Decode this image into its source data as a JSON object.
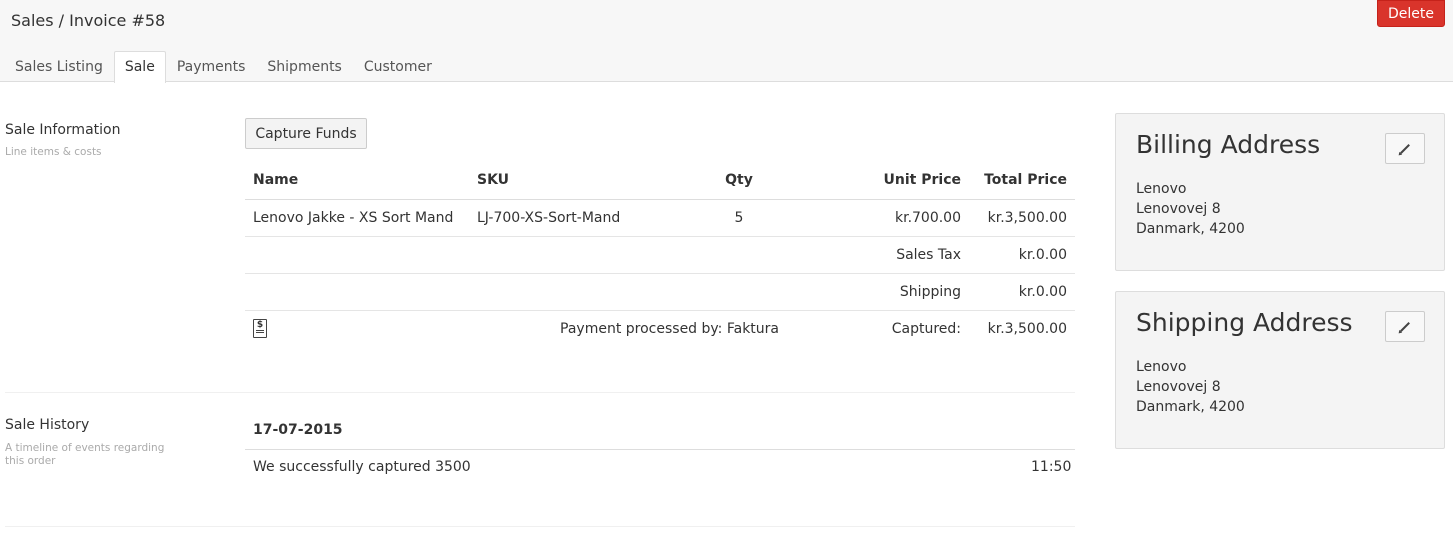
{
  "header": {
    "title": "Sales / Invoice #58",
    "delete_label": "Delete"
  },
  "tabs": [
    {
      "label": "Sales Listing",
      "active": false
    },
    {
      "label": "Sale",
      "active": true
    },
    {
      "label": "Payments",
      "active": false
    },
    {
      "label": "Shipments",
      "active": false
    },
    {
      "label": "Customer",
      "active": false
    }
  ],
  "sale_info": {
    "title": "Sale Information",
    "subtitle": "Line items & costs",
    "capture_label": "Capture Funds",
    "columns": {
      "name": "Name",
      "sku": "SKU",
      "qty": "Qty",
      "unit_price": "Unit Price",
      "total_price": "Total Price"
    },
    "items": [
      {
        "name": "Lenovo Jakke - XS Sort Mand",
        "sku": "LJ-700-XS-Sort-Mand",
        "qty": "5",
        "unit_price": "kr.700.00",
        "total_price": "kr.3,500.00"
      }
    ],
    "sales_tax_label": "Sales Tax",
    "sales_tax_value": "kr.0.00",
    "shipping_label": "Shipping",
    "shipping_value": "kr.0.00",
    "payment_icon": "invoice-dollar-icon",
    "payment_text": "Payment processed by: Faktura",
    "captured_label": "Captured:",
    "captured_value": "kr.3,500.00"
  },
  "sale_history": {
    "title": "Sale History",
    "subtitle": "A timeline of events regarding this order",
    "date": "17-07-2015",
    "event_text": "We successfully captured 3500",
    "event_time": "11:50"
  },
  "billing": {
    "title": "Billing Address",
    "lines": [
      "Lenovo",
      "Lenovovej 8",
      "Danmark, 4200"
    ]
  },
  "shipping": {
    "title": "Shipping Address",
    "lines": [
      "Lenovo",
      "Lenovovej 8",
      "Danmark, 4200"
    ]
  },
  "colors": {
    "delete": "#d9342b",
    "header_bg": "#f7f7f7",
    "panel_bg": "#f4f4f4"
  }
}
